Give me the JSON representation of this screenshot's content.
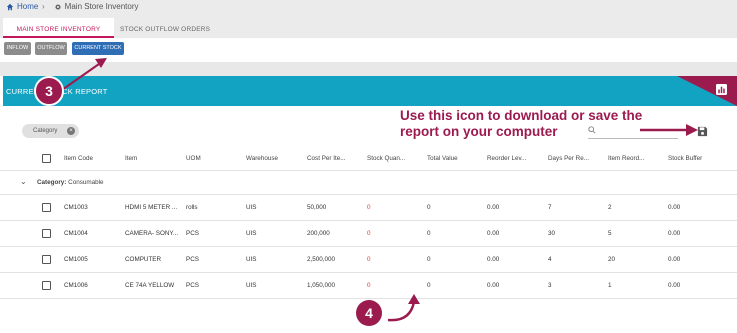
{
  "breadcrumb": {
    "home": "Home",
    "current": "Main Store Inventory"
  },
  "tabs": [
    {
      "label": "MAIN STORE INVENTORY"
    },
    {
      "label": "STOCK OUTFLOW ORDERS"
    }
  ],
  "buttons": {
    "inflow": "INFLOW",
    "outflow": "OUTFLOW",
    "current_stock": "CURRENT STOCK"
  },
  "report": {
    "title": "CURRENT STOCK REPORT"
  },
  "filter": {
    "chip": "Category"
  },
  "annotations": {
    "text": "Use this icon to download or save the report on your computer",
    "step3": "3",
    "step4": "4"
  },
  "columns": [
    "Item Code",
    "Item",
    "UOM",
    "Warehouse",
    "Cost Per Ite...",
    "Stock Quan...",
    "Total Value",
    "Reorder Lev...",
    "Days Per Re...",
    "Item Reord...",
    "Stock Buffer"
  ],
  "group": {
    "prefix": "Category:",
    "value": "Consumable"
  },
  "rows": [
    {
      "code": "CM1003",
      "item": "HDMI 5 METER ...",
      "uom": "rolls",
      "wh": "UIS",
      "cost": "50,000",
      "qty": "0",
      "total": "0",
      "reorder": "0.00",
      "days": "7",
      "itemreord": "2",
      "buffer": "0.00"
    },
    {
      "code": "CM1004",
      "item": "CAMERA- SONY...",
      "uom": "PCS",
      "wh": "UIS",
      "cost": "200,000",
      "qty": "0",
      "total": "0",
      "reorder": "0.00",
      "days": "30",
      "itemreord": "5",
      "buffer": "0.00"
    },
    {
      "code": "CM1005",
      "item": "COMPUTER",
      "uom": "PCS",
      "wh": "UIS",
      "cost": "2,500,000",
      "qty": "0",
      "total": "0",
      "reorder": "0.00",
      "days": "4",
      "itemreord": "20",
      "buffer": "0.00"
    },
    {
      "code": "CM1006",
      "item": "CE 74A YELLOW",
      "uom": "PCS",
      "wh": "UIS",
      "cost": "1,050,000",
      "qty": "0",
      "total": "0",
      "reorder": "0.00",
      "days": "3",
      "itemreord": "1",
      "buffer": "0.00"
    }
  ],
  "colors": {
    "accent": "#c2185b",
    "header": "#12a3c2",
    "annotation": "#9b1b4e",
    "button_blue": "#2f6db5"
  }
}
